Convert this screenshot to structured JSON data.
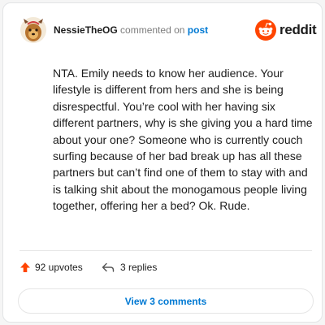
{
  "header": {
    "username": "NessieTheOG",
    "action": "commented on",
    "post_link": "post",
    "brand": "reddit"
  },
  "comment": {
    "text": "NTA. Emily needs to know her audience. Your lifestyle is different from hers and she is being disrespectful. You’re cool with her having six different partners, why is she giving you a hard time about your one? Someone who is currently couch surfing because of her bad break up has all these partners but can’t find one of them to stay with and is talking shit about the monogamous people living together, offering her a bed? Ok. Rude."
  },
  "footer": {
    "upvotes": "92 upvotes",
    "replies": "3 replies",
    "view_button": "View 3 comments"
  },
  "icons": {
    "avatar": "avatar-icon",
    "reddit": "reddit-logo-icon",
    "upvote": "upvote-arrow-icon",
    "reply": "reply-arrow-icon"
  },
  "colors": {
    "brand": "#ff4500",
    "link": "#0079d3",
    "text": "#1c1c1c",
    "muted": "#7c7c7c"
  }
}
